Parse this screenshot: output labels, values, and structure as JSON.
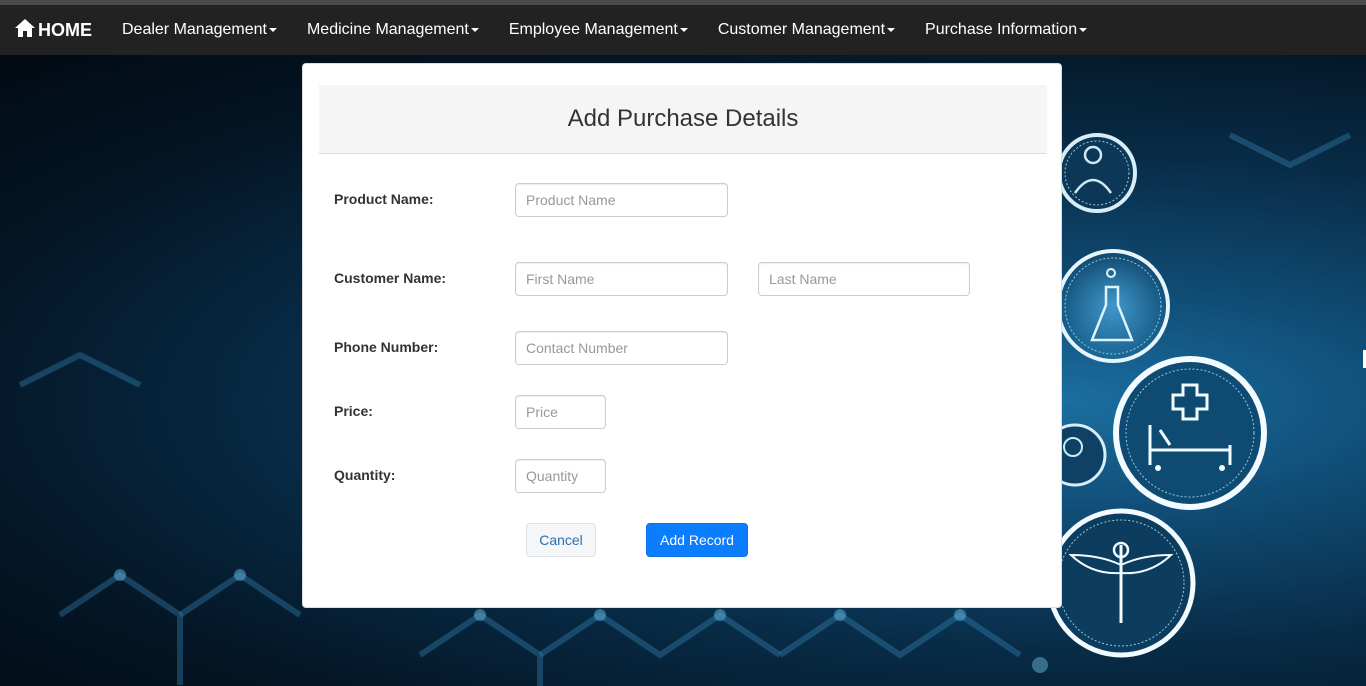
{
  "navbar": {
    "brand": "HOME",
    "items": [
      {
        "label": "Dealer Management"
      },
      {
        "label": "Medicine Management"
      },
      {
        "label": "Employee Management"
      },
      {
        "label": "Customer Management"
      },
      {
        "label": "Purchase Information"
      }
    ]
  },
  "modal": {
    "title": "Add Purchase Details",
    "fields": {
      "product_name": {
        "label": "Product Name:",
        "placeholder": "Product Name",
        "value": ""
      },
      "customer_name": {
        "label": "Customer Name:"
      },
      "first_name": {
        "placeholder": "First Name",
        "value": ""
      },
      "last_name": {
        "placeholder": "Last Name",
        "value": ""
      },
      "phone": {
        "label": "Phone Number:",
        "placeholder": "Contact Number",
        "value": ""
      },
      "price": {
        "label": "Price:",
        "placeholder": "Price",
        "value": ""
      },
      "quantity": {
        "label": "Quantity:",
        "placeholder": "Quantity",
        "value": ""
      }
    },
    "buttons": {
      "cancel": "Cancel",
      "add": "Add Record"
    }
  },
  "colors": {
    "navbar_bg": "#222222",
    "primary_button": "#0b7dff",
    "background_accent": "#1b6ea0"
  },
  "icons": [
    "home-icon",
    "doctor-icon",
    "flask-icon",
    "hospital-bed-icon",
    "nurse-icon",
    "caduceus-icon"
  ]
}
